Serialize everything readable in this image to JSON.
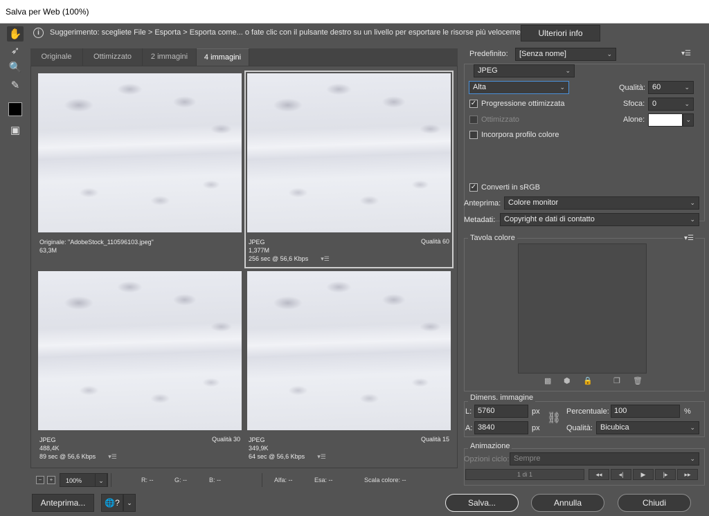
{
  "window": {
    "title": "Salva per Web (100%)"
  },
  "hint": {
    "text": "Suggerimento: scegliete File > Esporta > Esporta come... o fate clic con il pulsante destro su un livello per esportare le risorse più velocemente",
    "more_info_label": "Ulteriori info",
    "info_glyph": "i"
  },
  "tabs": [
    {
      "label": "Originale"
    },
    {
      "label": "Ottimizzato"
    },
    {
      "label": "2 immagini"
    },
    {
      "label": "4 immagini"
    }
  ],
  "panes": [
    {
      "line1": "Originale: \"AdobeStock_110596103.jpeg\"",
      "line2": "63,3M",
      "line3": "",
      "quality": ""
    },
    {
      "line1": "JPEG",
      "line2": "1,377M",
      "line3": "256 sec @ 56,6 Kbps",
      "quality": "Qualità 60"
    },
    {
      "line1": "JPEG",
      "line2": "488,4K",
      "line3": "89 sec @ 56,6 Kbps",
      "quality": "Qualità 30"
    },
    {
      "line1": "JPEG",
      "line2": "349,9K",
      "line3": "64 sec @ 56,6 Kbps",
      "quality": "Qualità 15"
    }
  ],
  "pane_menu_glyph": "▾☰",
  "status": {
    "zoom": "100%",
    "r": "R: --",
    "g": "G: --",
    "b": "B: --",
    "alpha": "Alfa: --",
    "hex": "Esa: --",
    "color_scale": "Scala colore: --"
  },
  "buttons": {
    "preview": "Anteprima...",
    "save": "Salva...",
    "cancel": "Annulla",
    "close": "Chiudi",
    "browser_glyph": "🌐?"
  },
  "settings": {
    "preset_label": "Predefinito:",
    "preset_value": "[Senza nome]",
    "format_value": "JPEG",
    "quality_preset": "Alta",
    "quality_label": "Qualità:",
    "quality_value": "60",
    "progressive_label": "Progressione ottimizzata",
    "blur_label": "Sfoca:",
    "blur_value": "0",
    "optimized_label": "Ottimizzato",
    "matte_label": "Alone:",
    "matte_color": "#ffffff",
    "embed_profile_label": "Incorpora profilo colore",
    "convert_srgb_label": "Converti in sRGB",
    "preview_label": "Anteprima:",
    "preview_value": "Colore monitor",
    "metadata_label": "Metadati:",
    "metadata_value": "Copyright e dati di contatto",
    "menu_glyph": "▾☰"
  },
  "color_table": {
    "title": "Tavola colore"
  },
  "image_size": {
    "title": "Dimens. immagine",
    "w_label": "L:",
    "w_value": "5760",
    "h_label": "A:",
    "h_value": "3840",
    "unit": "px",
    "percent_label": "Percentuale:",
    "percent_value": "100",
    "percent_unit": "%",
    "quality_label": "Qualità:",
    "quality_value": "Bicubica"
  },
  "animation": {
    "title": "Animazione",
    "loop_label": "Opzioni ciclo:",
    "loop_value": "Sempre",
    "frame_counter": "1 di 1"
  },
  "colors": {
    "panel_bg": "#535353",
    "field_bg": "#3c3c3c",
    "accent": "#4a90d9"
  }
}
